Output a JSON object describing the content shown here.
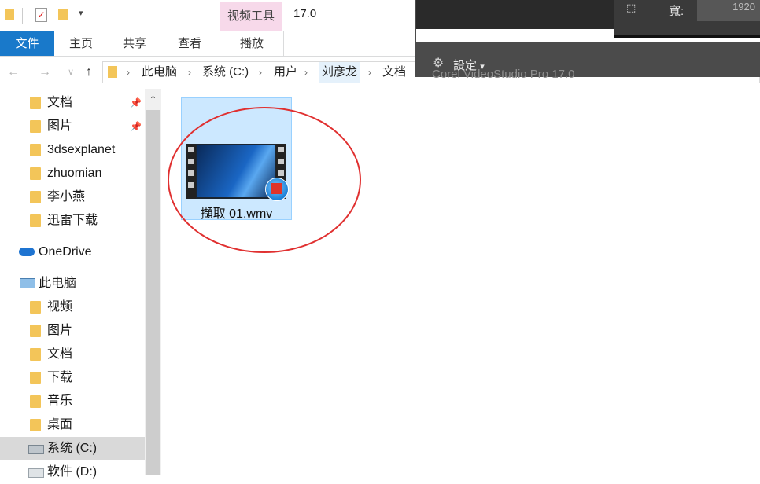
{
  "titlebar": {
    "title": "17.0",
    "context_tab": "视频工具"
  },
  "ribbon": {
    "tabs": [
      "文件",
      "主页",
      "共享",
      "查看",
      "播放"
    ]
  },
  "address": {
    "crumbs": [
      "此电脑",
      "系统 (C:)",
      "用户",
      "刘彦龙",
      "文档"
    ],
    "ghost": "Corel VideoStudio Pro    17.0"
  },
  "sidebar": {
    "quick": [
      {
        "label": "文档",
        "pinned": true
      },
      {
        "label": "图片",
        "pinned": true
      },
      {
        "label": "3dsexplanet"
      },
      {
        "label": "zhuomian"
      },
      {
        "label": "李小燕"
      },
      {
        "label": "迅雷下载"
      }
    ],
    "onedrive": "OneDrive",
    "thispc": "此电脑",
    "pc_items": [
      "视频",
      "图片",
      "文档",
      "下载",
      "音乐",
      "桌面",
      "系统 (C:)",
      "软件 (D:)"
    ]
  },
  "file": {
    "name": "擷取 01.wmv"
  },
  "overlay": {
    "width_label": "寬:",
    "width_value": "1920",
    "settings": "設定"
  },
  "icons": [
    "folder-icon",
    "checkbox-icon",
    "dropdown-icon",
    "back-arrow-icon",
    "forward-arrow-icon",
    "up-arrow-icon",
    "pin-icon",
    "cloud-icon",
    "computer-icon",
    "gear-icon",
    "video-file-icon"
  ],
  "colors": {
    "accent": "#1979ca",
    "selection": "#cce8ff",
    "context_tab": "#f7d9ea",
    "annotation": "#e03030"
  }
}
